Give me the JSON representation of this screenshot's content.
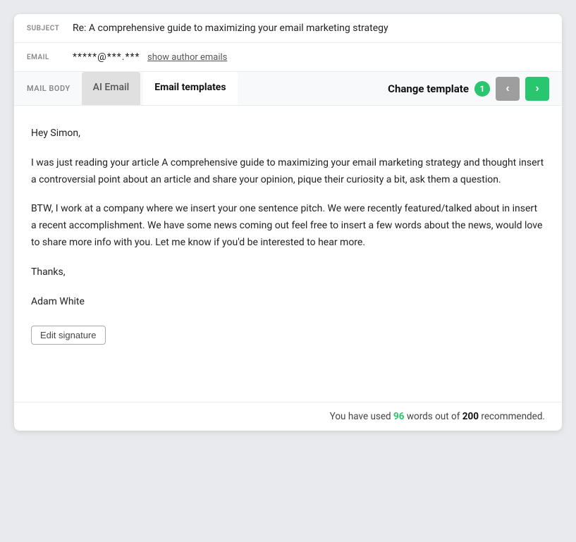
{
  "subject": {
    "label": "SUBJECT",
    "value": "Re: A comprehensive guide to maximizing your email marketing strategy"
  },
  "email": {
    "label": "EMAIL",
    "masked": "*****@***.***",
    "show_link": "show author emails"
  },
  "tabs_bar": {
    "mail_body_label": "MAIL BODY",
    "tab_ai_email": "AI Email",
    "tab_email_templates": "Email templates",
    "change_template_label": "Change template",
    "badge_count": "1",
    "prev_icon": "‹",
    "next_icon": "›"
  },
  "email_body": {
    "greeting": "Hey Simon,",
    "paragraph1": "I was just reading your article A comprehensive guide to maximizing your email marketing strategy and thought insert a controversial point about an article and share your opinion, pique their curiosity a bit, ask them a question.",
    "paragraph2": "BTW, I work at a company where we insert your one sentence pitch. We were recently featured/talked about in insert a recent accomplishment. We have some news coming out feel free to insert a few words about the news, would love to share more info with you. Let me know if you'd be interested to hear more.",
    "thanks": "Thanks,",
    "author": "Adam White",
    "edit_signature_label": "Edit signature"
  },
  "footer": {
    "prefix": "You have used",
    "used_count": "96",
    "middle": "words out of",
    "total_count": "200",
    "suffix": "recommended."
  }
}
